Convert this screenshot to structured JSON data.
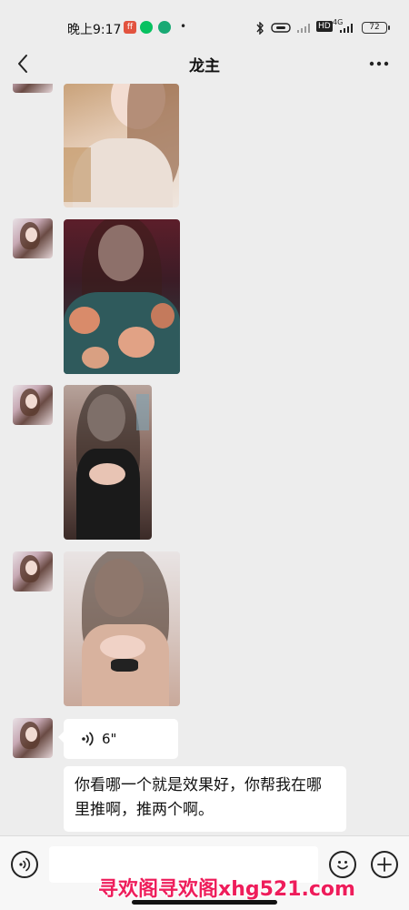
{
  "status_bar": {
    "time": "晚上9:17",
    "app_badge_1": "ff",
    "network": "4G",
    "hd": "HD",
    "battery": "72"
  },
  "header": {
    "title": "龙主"
  },
  "messages": [
    {
      "type": "image",
      "from": "contact"
    },
    {
      "type": "image",
      "from": "contact"
    },
    {
      "type": "image",
      "from": "contact"
    },
    {
      "type": "image",
      "from": "contact"
    },
    {
      "type": "voice",
      "from": "contact",
      "duration": "6\""
    },
    {
      "type": "text",
      "from": "contact",
      "text": "你看哪一个就是效果好，你帮我在哪里推啊，推两个啊。"
    }
  ],
  "input_bar": {
    "placeholder": ""
  },
  "watermark": "寻欢阁寻欢阁xhg521.com",
  "colors": {
    "background": "#ededed",
    "bubble": "#ffffff",
    "watermark": "#ee1d5b"
  },
  "icons": [
    "back-icon",
    "more-icon",
    "voice-icon",
    "emoji-icon",
    "plus-icon"
  ]
}
